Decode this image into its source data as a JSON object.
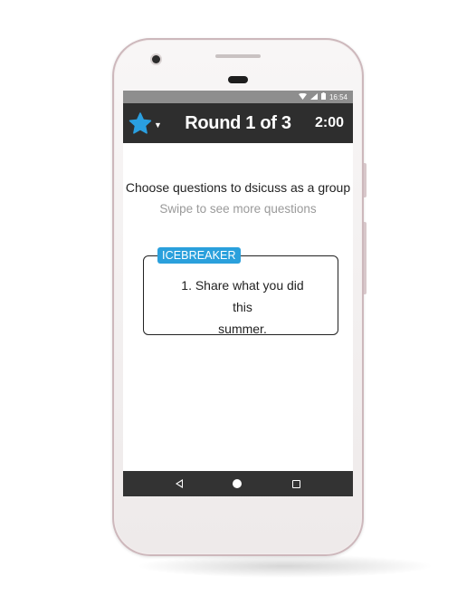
{
  "status_bar": {
    "time": "16:54",
    "icons": [
      "wifi-icon",
      "signal-icon",
      "battery-icon"
    ]
  },
  "app_bar": {
    "menu_icon": "star-icon",
    "title": "Round 1 of 3",
    "timer": "2:00"
  },
  "content": {
    "prompt": "Choose questions to dsicuss as a group",
    "hint": "Swipe to see more questions"
  },
  "question_card": {
    "tag": "ICEBREAKER",
    "text_line1": "1.  Share what you did this",
    "text_line2": "summer."
  },
  "nav_bar": {
    "icons": [
      "back-icon",
      "home-icon",
      "recents-icon"
    ]
  },
  "colors": {
    "accent": "#2aa0dc",
    "app_bar": "#2e2e2e",
    "status_bar": "#8e8e8e",
    "nav_bar": "#333333"
  }
}
